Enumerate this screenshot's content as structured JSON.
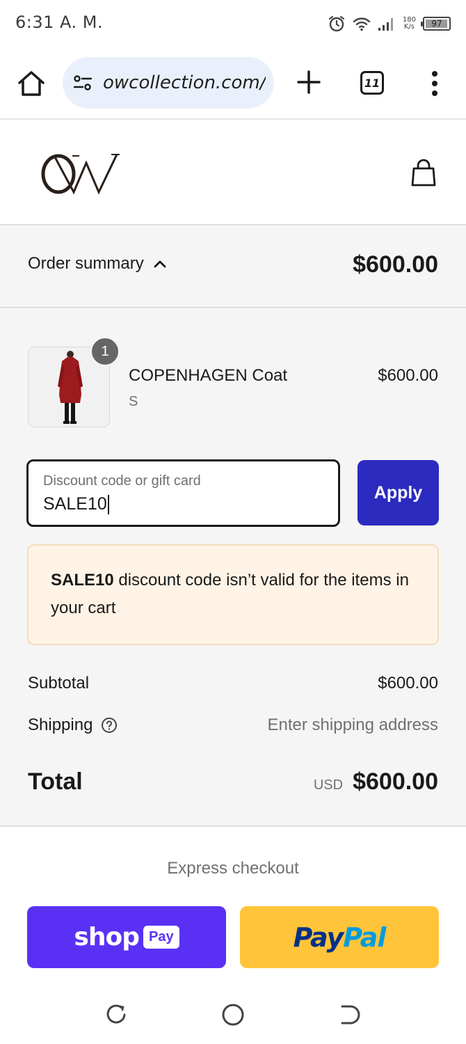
{
  "status_bar": {
    "time": "6:31 A. M.",
    "net_speed_value": "180",
    "net_speed_unit": "K/s",
    "battery_level": "97"
  },
  "browser": {
    "url": "owcollection.com/",
    "tab_count": "11"
  },
  "site": {
    "logo_text": "OW"
  },
  "order_summary": {
    "label": "Order summary",
    "total": "$600.00"
  },
  "cart": {
    "items": [
      {
        "name": "COPENHAGEN Coat",
        "variant": "S",
        "price": "$600.00",
        "quantity": "1"
      }
    ]
  },
  "discount": {
    "placeholder": "Discount code or gift card",
    "value": "SALE10",
    "apply_label": "Apply"
  },
  "alert": {
    "code": "SALE10",
    "message": " discount code isn’t valid for the items in your cart"
  },
  "totals": {
    "subtotal_label": "Subtotal",
    "subtotal_value": "$600.00",
    "shipping_label": "Shipping",
    "shipping_value": "Enter shipping address",
    "total_label": "Total",
    "currency": "USD",
    "total_value": "$600.00"
  },
  "express": {
    "label": "Express checkout",
    "shop_pay_word": "shop",
    "shop_pay_box": "Pay",
    "paypal_part1": "Pay",
    "paypal_part2": "Pal"
  },
  "colors": {
    "accent": "#2b2bc0",
    "shop_pay": "#5a31f4",
    "paypal_yellow": "#ffc439",
    "alert_bg": "#fff3e6"
  }
}
